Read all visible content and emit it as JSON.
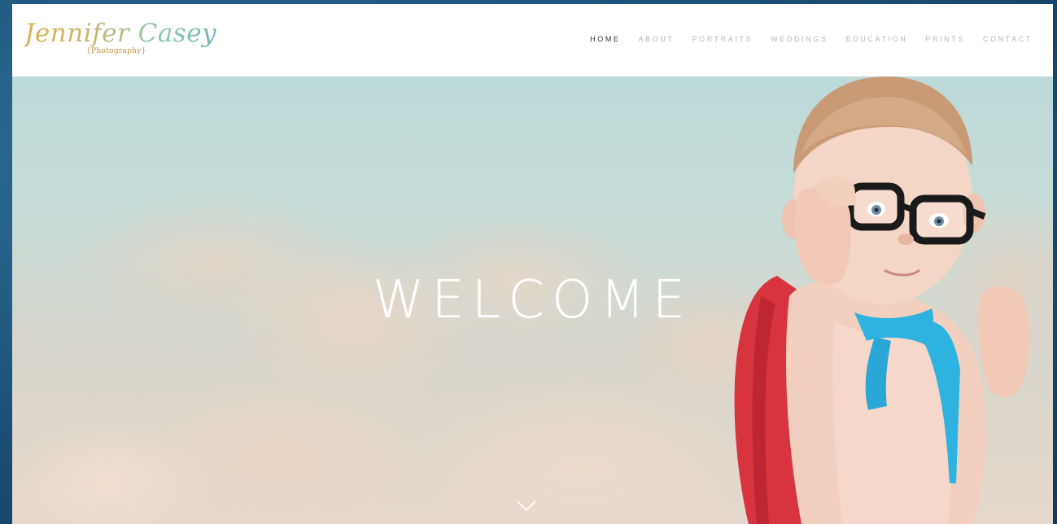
{
  "site": {
    "logo_text": "Jennifer Casey",
    "logo_subtext": "{Photography}"
  },
  "nav": {
    "items": [
      {
        "label": "HOME",
        "active": true
      },
      {
        "label": "ABOUT",
        "active": false
      },
      {
        "label": "PORTRAITS",
        "active": false
      },
      {
        "label": "WEDDINGS",
        "active": false
      },
      {
        "label": "EDUCATION",
        "active": false
      },
      {
        "label": "PRINTS",
        "active": false
      },
      {
        "label": "CONTACT",
        "active": false
      }
    ]
  },
  "hero": {
    "heading": "WELCOME",
    "scroll_icon": "chevron-down-icon"
  },
  "colors": {
    "nav_active": "#333333",
    "nav_inactive": "#b7b7b7",
    "sky": "#bcdad8",
    "cape": "#d8343f",
    "ribbon": "#2eb3e0"
  }
}
